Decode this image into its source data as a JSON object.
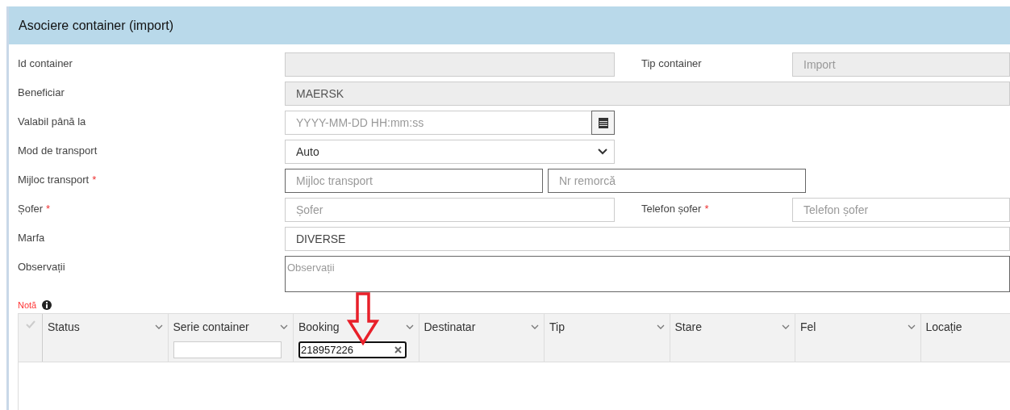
{
  "panel": {
    "title": "Asociere container (import)"
  },
  "form": [
    {
      "label": "Id container",
      "fields": [
        {
          "kind": "input",
          "disabled": true
        }
      ],
      "side": {
        "label": "Tip container",
        "field": {
          "kind": "input",
          "value": "Import",
          "disabled": true
        }
      }
    },
    {
      "label": "Beneficiar",
      "wide": true,
      "fields": [
        {
          "kind": "input",
          "value": "MAERSK",
          "disabled": true
        }
      ]
    },
    {
      "label": "Valabil până la",
      "fields": [
        {
          "kind": "date",
          "placeholder": "YYYY-MM-DD HH:mm:ss"
        }
      ]
    },
    {
      "label": "Mod de transport",
      "fields": [
        {
          "kind": "select",
          "value": "Auto"
        }
      ]
    },
    {
      "label": "Mijloc transport",
      "marker": "*",
      "fields": [
        {
          "kind": "input",
          "placeholder": "Mijloc transport",
          "disabled": false,
          "focused": true
        },
        {
          "kind": "input",
          "placeholder": "Nr remorcă",
          "disabled": false,
          "focused": true
        }
      ]
    },
    {
      "label": "Șofer",
      "marker": "*",
      "fields": [
        {
          "kind": "input",
          "placeholder": "Șofer",
          "disabled": false
        }
      ],
      "side": {
        "label": "Telefon șofer",
        "marker": "*",
        "field": {
          "kind": "input",
          "placeholder": "Telefon șofer",
          "disabled": false
        }
      }
    },
    {
      "label": "Marfa",
      "wide": true,
      "fields": [
        {
          "kind": "input",
          "value": "DIVERSE",
          "disabled": false
        }
      ]
    },
    {
      "label": "Observații",
      "wide": true,
      "fields": [
        {
          "kind": "textarea",
          "placeholder": "Observații"
        }
      ]
    }
  ],
  "note": {
    "label": "Notă"
  },
  "grid": {
    "select_all": {
      "checked": false
    },
    "columns": [
      {
        "label": "Status",
        "menu": true,
        "filter": false
      },
      {
        "label": "Serie container",
        "menu": true,
        "filter": true
      },
      {
        "label": "Booking",
        "menu": true,
        "filter": true,
        "filter_value": "218957226"
      },
      {
        "label": "Destinatar",
        "menu": true,
        "filter": false
      },
      {
        "label": "Tip",
        "menu": true,
        "filter": false
      },
      {
        "label": "Stare",
        "menu": true,
        "filter": false
      },
      {
        "label": "Fel",
        "menu": true,
        "filter": false
      },
      {
        "label": "Locație",
        "menu": false,
        "filter": false
      }
    ]
  }
}
